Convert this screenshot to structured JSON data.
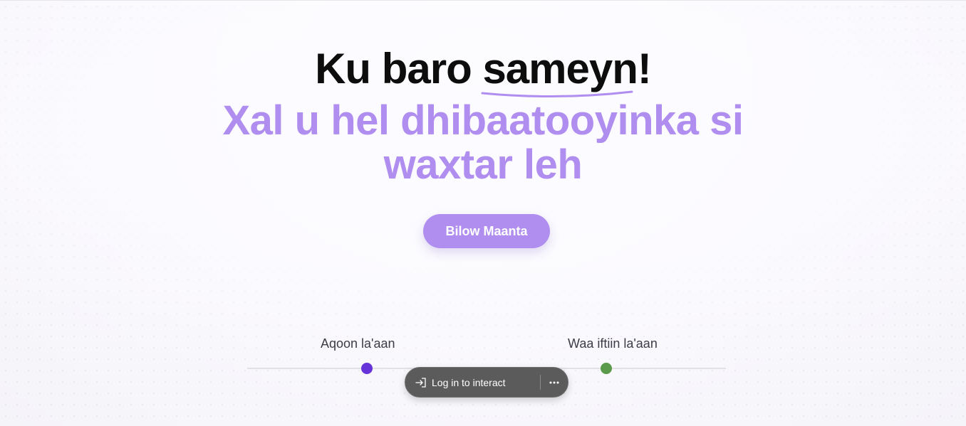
{
  "hero": {
    "headline_prefix": "Ku baro ",
    "headline_highlight": "sameyn",
    "headline_suffix": "!",
    "subheadline": "Xal u hel dhibaatooyinka si waxtar leh",
    "cta_label": "Bilow Maanta"
  },
  "timeline": {
    "steps": [
      {
        "label": "Aqoon la'aan",
        "color": "#6633d9"
      },
      {
        "label": "Waa iftiin la'aan",
        "color": "#5a9a4a"
      }
    ]
  },
  "toast": {
    "label": "Log in to interact",
    "login_icon": "login-arrow-icon",
    "more_icon": "more-horizontal-icon"
  },
  "colors": {
    "accent": "#b08ef0",
    "headline": "#0d0d0d"
  }
}
